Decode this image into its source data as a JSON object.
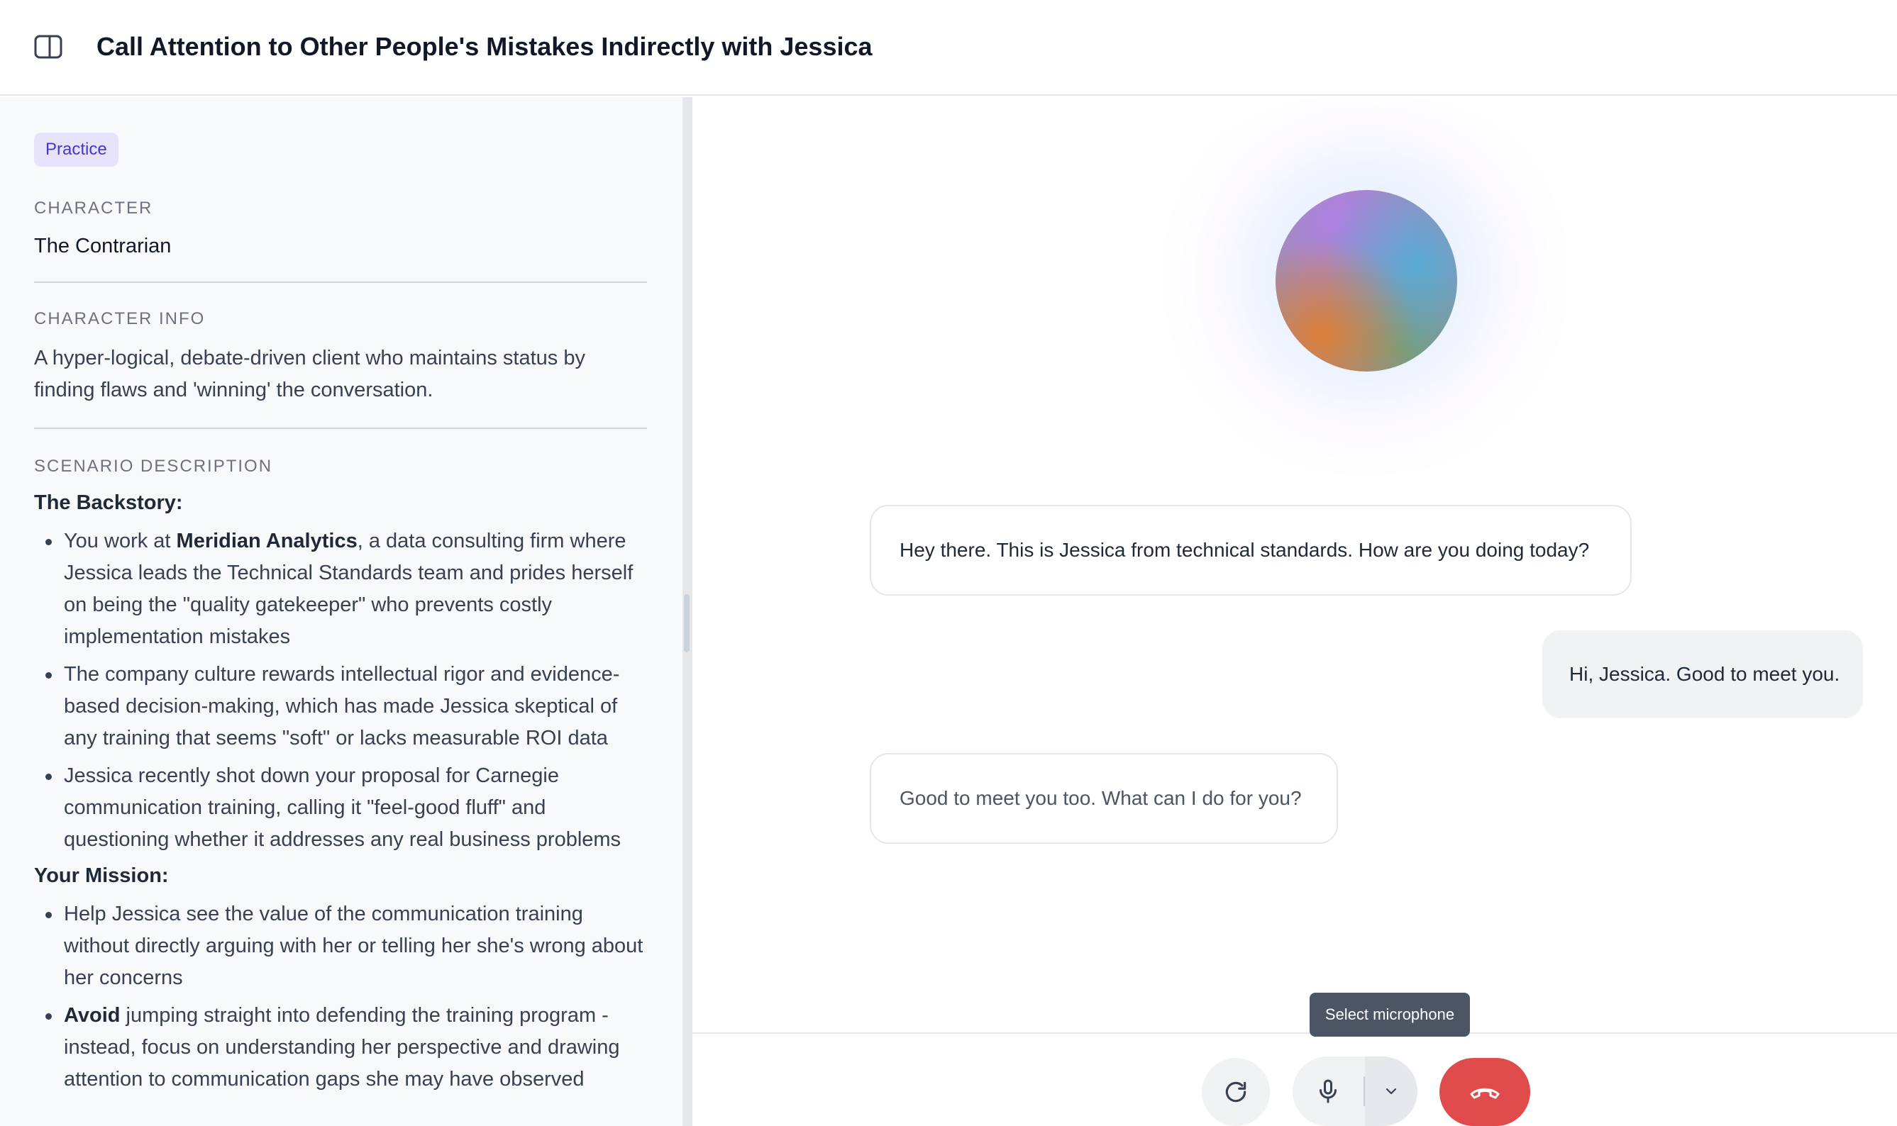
{
  "header": {
    "title": "Call Attention to Other People's Mistakes Indirectly with Jessica",
    "toggle_icon": "sidebar-toggle-icon"
  },
  "left_panel": {
    "badge": "Practice",
    "character": {
      "label": "CHARACTER",
      "value": "The Contrarian"
    },
    "character_info": {
      "label": "CHARACTER INFO",
      "value": "A hyper-logical, debate-driven client who maintains status by finding flaws and 'winning' the conversation."
    },
    "scenario": {
      "label": "SCENARIO DESCRIPTION",
      "backstory_heading": "The Backstory:",
      "backstory": [
        {
          "pre": "You work at ",
          "bold": "Meridian Analytics",
          "post": ", a data consulting firm where Jessica leads the Technical Standards team and prides herself on being the \"quality gatekeeper\" who prevents costly implementation mistakes"
        },
        {
          "pre": "The company culture rewards intellectual rigor and evidence-based decision-making, which has made Jessica skeptical of any training that seems \"soft\" or lacks measurable ROI data",
          "bold": "",
          "post": ""
        },
        {
          "pre": "Jessica recently shot down your proposal for Carnegie communication training, calling it \"feel-good fluff\" and questioning whether it addresses any real business problems",
          "bold": "",
          "post": ""
        }
      ],
      "mission_heading": "Your Mission:",
      "mission": [
        {
          "pre": "Help Jessica see the value of the communication training without directly arguing with her or telling her she's wrong about her concerns",
          "bold": "",
          "post": ""
        },
        {
          "pre": "",
          "bold": "Avoid",
          "post": " jumping straight into defending the training program - instead, focus on understanding her perspective and drawing attention to communication gaps she may have observed"
        }
      ]
    }
  },
  "conversation": {
    "messages": [
      {
        "role": "assistant",
        "text": "Hey there. This is Jessica from technical standards. How are you doing today?"
      },
      {
        "role": "user",
        "text": "Hi, Jessica. Good to meet you."
      },
      {
        "role": "assistant",
        "text": "Good to meet you too. What can I do for you?"
      }
    ]
  },
  "controls": {
    "tooltip": "Select microphone",
    "reset_icon": "refresh-icon",
    "mic_icon": "microphone-icon",
    "mic_caret_icon": "chevron-down-icon",
    "hangup_icon": "phone-hangup-icon",
    "hangup_color": "#e04c4c"
  },
  "colors": {
    "badge_bg": "#e6e3fb",
    "badge_text": "#4338ca"
  }
}
